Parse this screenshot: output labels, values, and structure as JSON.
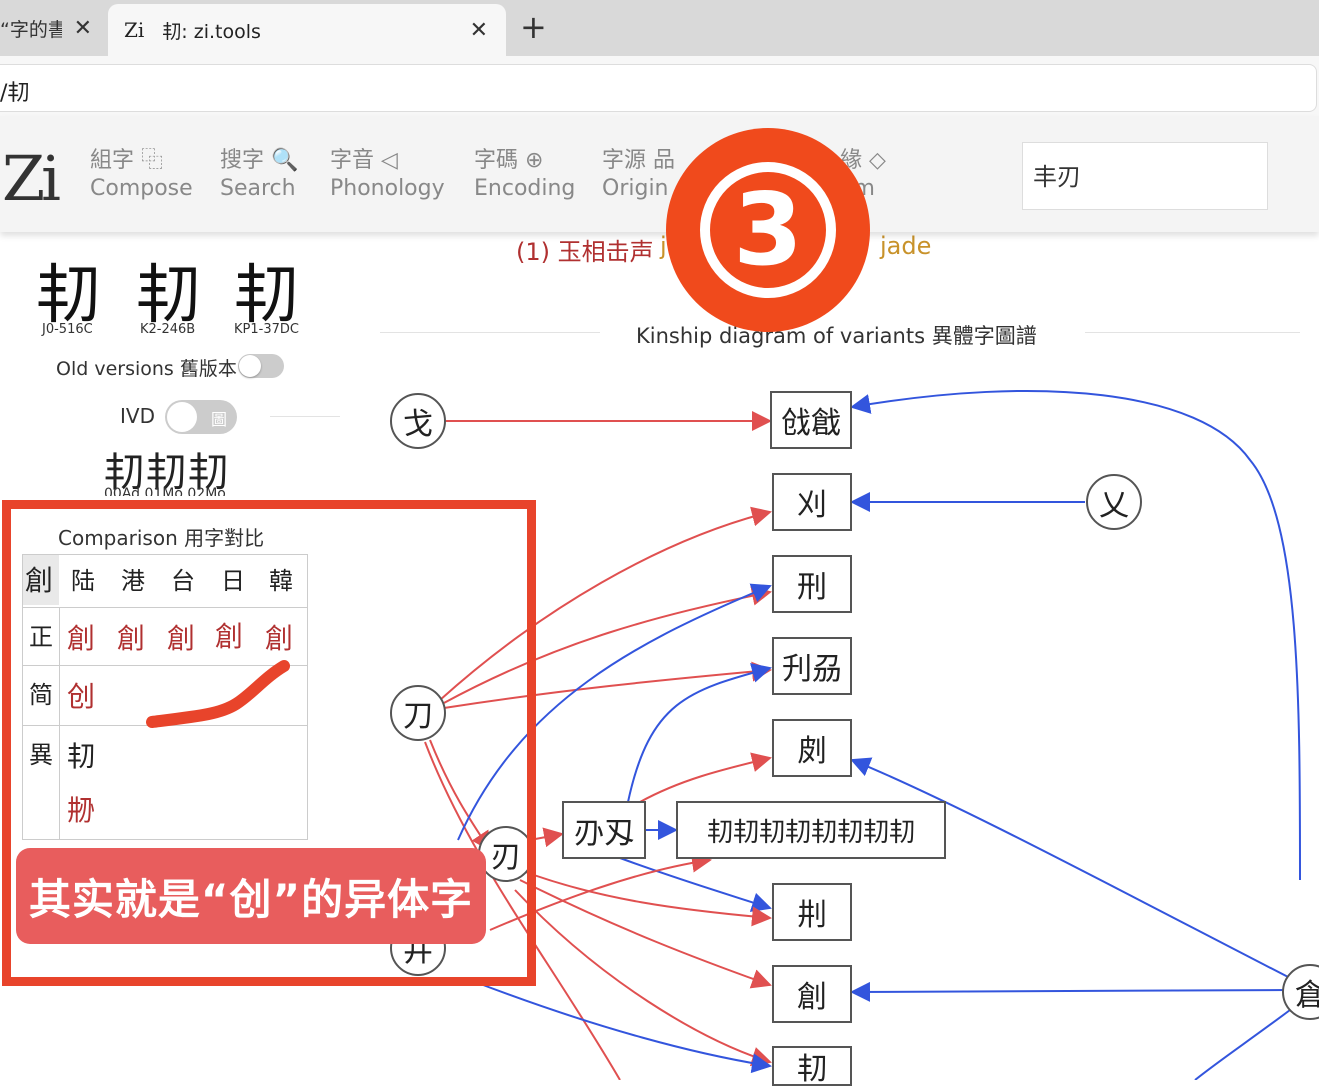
{
  "browser": {
    "tabs": [
      {
        "title": "“字的書",
        "active": false
      },
      {
        "favicon": "Zi",
        "title": "㓞: zi.tools",
        "active": true
      }
    ],
    "close_glyph": "✕",
    "newtab_glyph": "+",
    "address": "/㓞"
  },
  "site": {
    "logo": "Zi",
    "nav": [
      {
        "zh": "組字 ⿻",
        "en": "Compose"
      },
      {
        "zh": "搜字 🔍",
        "en": "Search"
      },
      {
        "zh": "字音 ◁",
        "en": "Phonology"
      },
      {
        "zh": "字碼 ⊕",
        "en": "Encoding"
      },
      {
        "zh": "字源 品",
        "en": "Origin"
      },
      {
        "zh": "緣 ◇",
        "en": "om"
      }
    ],
    "search_value": "丰刃"
  },
  "glyphs": {
    "main": [
      {
        "char": "㓞",
        "code": "J0-516C"
      },
      {
        "char": "㓞",
        "code": "K2-246B"
      },
      {
        "char": "㓞",
        "code": "KP1-37DC"
      }
    ],
    "old_versions_label": "Old versions 舊版本",
    "ivd_label": "IVD",
    "ivd_toggle_text": "圖",
    "ivd_chars": "㓞㓞㓞",
    "ivd_codes": "00Ad  01Mo  02Mo"
  },
  "comparison": {
    "title": "Comparison 用字對比",
    "header": [
      "創",
      "陆",
      "港",
      "台",
      "日",
      "韓"
    ],
    "rows": [
      {
        "label": "正",
        "cells": [
          "創",
          "創",
          "創",
          "創",
          "創"
        ]
      },
      {
        "label": "简",
        "cells": [
          "创"
        ]
      },
      {
        "label": "異",
        "cells": [
          "㓞",
          "刱"
        ]
      }
    ]
  },
  "annotation": {
    "caption": "其实就是“创”的异体字",
    "badge": "3"
  },
  "meaning": {
    "prefix": "(1) 玉相击声",
    "left_fragment": "j",
    "right_fragment": "jade"
  },
  "diagram": {
    "title": "Kinship diagram of variants 異體字圖譜",
    "circles": [
      "戈",
      "乂",
      "刀",
      "刃",
      "井",
      "倉"
    ],
    "boxes": [
      "戗戧",
      "刈",
      "刑",
      "刋刕",
      "㓟",
      "刅刄",
      "㓞㓞㓞㓞㓞㓞㓞㓞",
      "㓝",
      "創",
      "㓞"
    ]
  },
  "colors": {
    "accent_red": "#e8442b",
    "badge": "#f04a1c",
    "caption_bg": "#e85d5d",
    "edge_red": "#e05050",
    "edge_blue": "#3355dd",
    "variant_red": "#b03030"
  }
}
